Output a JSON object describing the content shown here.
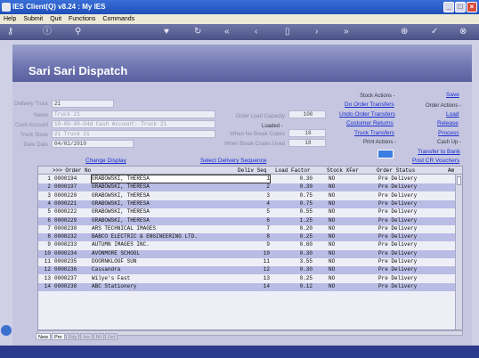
{
  "window": {
    "title": "IES Client(Q) v8.24 : My IES"
  },
  "menu": [
    "Help",
    "Submit",
    "Quit",
    "Functions",
    "Commands"
  ],
  "toolbar_icons": [
    "key-icon",
    "info-icon",
    "search-icon",
    "heart-icon",
    "refresh-icon",
    "rewind-icon",
    "back-icon",
    "forward-icon",
    "fast-forward-icon",
    "trash-icon",
    "add-icon",
    "check-icon",
    "close-icon"
  ],
  "page": {
    "title": "Sari Sari Dispatch"
  },
  "form": {
    "delivery_truck_label": "Delivery Truck",
    "delivery_truck": "21",
    "name_label": "Name",
    "name": "Truck 21",
    "cash_account_label": "Cash Account",
    "cash_account": "10-00-00-04d Cash Account: Truck 21",
    "truck_stock_label": "Truck Stock",
    "truck_stock": "21 Truck 21",
    "deliv_date_label": "Deliv Date",
    "deliv_date": "04/02/2010",
    "order_load_capacity_label": "Order Load Capacity",
    "order_load_capacity": "100",
    "loaded_label": "Loaded -",
    "when_no_break_crates_label": "When No Break Crates",
    "when_no_break_crates": "18",
    "when_break_crates_used_label": "When Break Crates Used",
    "when_break_crates_used": "18"
  },
  "stock_actions": {
    "heading": "Stock Actions -",
    "do_order_transfers": "Do Order Transfers",
    "undo_order_transfers": "Undo Order Transfers",
    "customer_returns": "Customer Returns",
    "truck_transfers": "Truck Transfers"
  },
  "order_actions": {
    "save": "Save",
    "heading": "Order Actions -",
    "load": "Load",
    "release": "Release",
    "process": "Process"
  },
  "print_actions": {
    "heading": "Print Actions -"
  },
  "cash_up": {
    "heading": "Cash Up -",
    "transfer_to_bank": "Transfer to Bank",
    "post_cr_vouchers": "Post CR Vouchers"
  },
  "change_display": "Change Display",
  "select_delivery_sequence": "Select Delivery Sequence",
  "grid": {
    "headers": [
      ">>> Order No",
      "Deliv Seq",
      "Load Factor",
      "Stock XFer",
      "Order Status",
      "Am"
    ],
    "rows": [
      [
        "1",
        "0000194",
        "GRABOWSKI, THERESA",
        "1",
        "0.30",
        "NO",
        "Pre Delivery"
      ],
      [
        "2",
        "0000197",
        "GRABOWSKI, THERESA",
        "2",
        "0.30",
        "NO",
        "Pre Delivery"
      ],
      [
        "3",
        "0000220",
        "GRABOWSKI, THERESA",
        "3",
        "0.75",
        "NO",
        "Pre Delivery"
      ],
      [
        "4",
        "0000221",
        "GRABOWSKI, THERESA",
        "4",
        "0.75",
        "NO",
        "Pre Delivery"
      ],
      [
        "5",
        "0000222",
        "GRABOWSKI, THERESA",
        "5",
        "0.55",
        "NO",
        "Pre Delivery"
      ],
      [
        "6",
        "0000229",
        "GRABOWSKI, THERESA",
        "6",
        "1.25",
        "NO",
        "Pre Delivery"
      ],
      [
        "7",
        "0000230",
        "ARS TECHNICAL IMAGES",
        "7",
        "0.20",
        "NO",
        "Pre Delivery"
      ],
      [
        "8",
        "0000232",
        "BABCO ELECTRIC & ENGINEERING LTD.",
        "8",
        "0.25",
        "NO",
        "Pre Delivery"
      ],
      [
        "9",
        "0000233",
        "AUTUMN IMAGES INC.",
        "9",
        "0.60",
        "NO",
        "Pre Delivery"
      ],
      [
        "10",
        "0000234",
        "AVONMORE SCHOOL",
        "10",
        "0.30",
        "NO",
        "Pre Delivery"
      ],
      [
        "11",
        "0000235",
        "DOORNKLOOF SUN",
        "11",
        "3.55",
        "NO",
        "Pre Delivery"
      ],
      [
        "12",
        "0000236",
        "Cassandra",
        "12",
        "0.30",
        "NO",
        "Pre Delivery"
      ],
      [
        "13",
        "0000237",
        "Wilye's Fast",
        "13",
        "0.25",
        "NO",
        "Pre Delivery"
      ],
      [
        "14",
        "0000238",
        "ABC Stationery",
        "14",
        "0.12",
        "NO",
        "Pre Delivery"
      ]
    ]
  },
  "tabs": [
    "New",
    "Pre",
    "Rdy",
    "Ins",
    "Bil",
    "Del"
  ]
}
